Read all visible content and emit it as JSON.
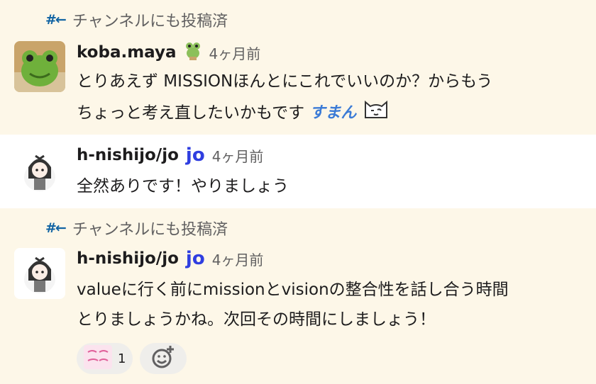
{
  "messages": [
    {
      "shared_label": "チャンネルにも投稿済",
      "author": "koba.maya",
      "time": "4ヶ月前",
      "line1": "とりあえず MISSIONほんとにこれでいいのか？からもう",
      "line2": "ちょっと考え直したいかもです",
      "emoji_text": "すまん"
    },
    {
      "author": "h-nishijo/jo",
      "badge": "jo",
      "time": "4ヶ月前",
      "line1": "全然ありです！やりましょう"
    },
    {
      "shared_label": "チャンネルにも投稿済",
      "author": "h-nishijo/jo",
      "badge": "jo",
      "time": "4ヶ月前",
      "line1": "valueに行く前にmissionとvisionの整合性を話し合う時間",
      "line2": "とりましょうかね。次回その時間にしましょう！"
    }
  ],
  "reactions": [
    {
      "emoji_label": "ありがとうございます",
      "count": "1"
    }
  ],
  "colors": {
    "highlight_bg": "#fdf7e8",
    "link_blue": "#1264a3",
    "badge_blue": "#2f3ee0"
  }
}
